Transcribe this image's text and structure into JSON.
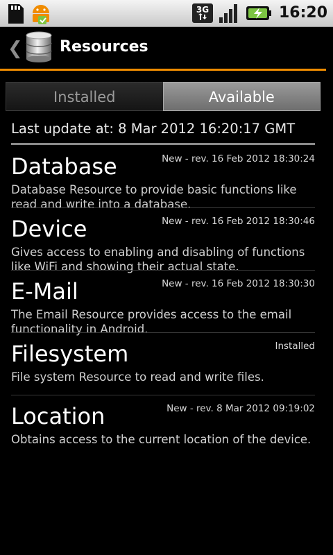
{
  "status_bar": {
    "time": "16:20",
    "left_icons": [
      "sd-card-icon",
      "android-debug-icon"
    ],
    "right_icons": [
      "3g-data-icon",
      "signal-strength-icon",
      "battery-charging-icon"
    ]
  },
  "titlebar": {
    "title": "Resources",
    "back_glyph": "❮",
    "accent_color": "#f08c00"
  },
  "tabs": [
    {
      "label": "Installed",
      "selected": false
    },
    {
      "label": "Available",
      "selected": true
    }
  ],
  "last_update": "Last update at: 8 Mar 2012 16:20:17 GMT",
  "resources": [
    {
      "name": "Database",
      "status": "New - rev. 16 Feb 2012 18:30:24",
      "description": "Database Resource to provide basic functions like read and write into a database."
    },
    {
      "name": "Device",
      "status": "New - rev. 16 Feb 2012 18:30:46",
      "description": "Gives access to enabling and disabling of functions like WiFi and showing their actual state."
    },
    {
      "name": "E-Mail",
      "status": "New - rev. 16 Feb 2012 18:30:30",
      "description": "The Email Resource provides access to the email functionality in Android."
    },
    {
      "name": "Filesystem",
      "status": "Installed",
      "description": "File system Resource to read and write files."
    },
    {
      "name": "Location",
      "status": "New - rev. 8 Mar 2012 09:19:02",
      "description": "Obtains access to the current location of the device."
    }
  ]
}
